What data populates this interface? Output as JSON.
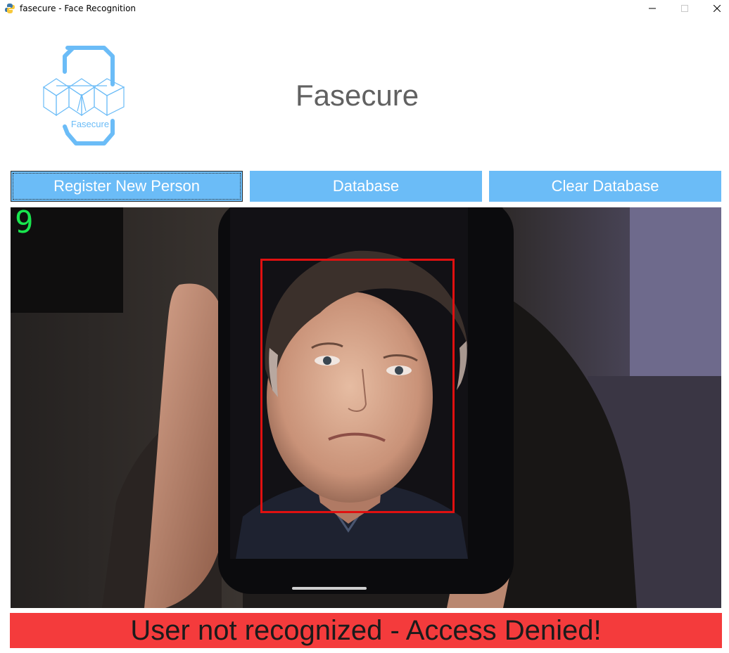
{
  "window": {
    "title": "fasecure - Face Recognition",
    "controls": [
      "minimize-icon",
      "maximize-icon",
      "close-icon"
    ]
  },
  "header": {
    "logo_text": "Fasecure",
    "title": "Fasecure"
  },
  "buttons": {
    "register": "Register New Person",
    "database": "Database",
    "clear": "Clear Database"
  },
  "feed": {
    "frame_counter": "9",
    "face_detected": true,
    "face_box_color": "#e01010"
  },
  "status": {
    "message": "User not recognized - Access Denied!",
    "color": "#f43b3c"
  },
  "colors": {
    "accent": "#6bbcf7",
    "counter": "#19e54e"
  }
}
